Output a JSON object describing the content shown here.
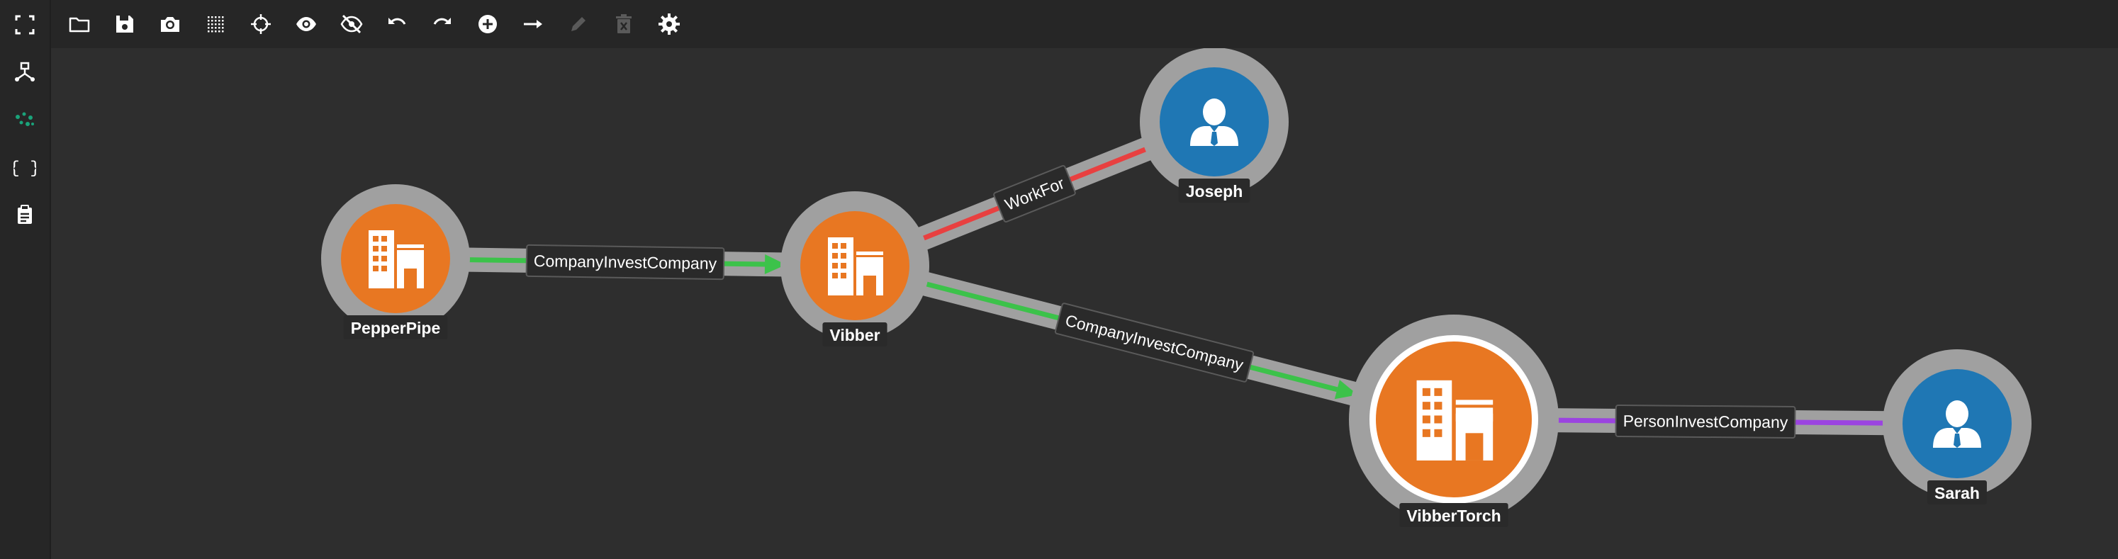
{
  "sidebar": {
    "items": [
      {
        "name": "fullscreen-icon"
      },
      {
        "name": "graph-schema-icon"
      },
      {
        "name": "graph-view-icon",
        "active_color": "#1aa37a"
      },
      {
        "name": "json-view-icon"
      },
      {
        "name": "clipboard-icon"
      }
    ]
  },
  "toolbar": {
    "items": [
      {
        "name": "open-folder-icon"
      },
      {
        "name": "save-icon"
      },
      {
        "name": "camera-icon"
      },
      {
        "name": "grid-icon"
      },
      {
        "name": "crosshair-icon"
      },
      {
        "name": "eye-icon"
      },
      {
        "name": "eye-off-icon"
      },
      {
        "name": "undo-icon"
      },
      {
        "name": "redo-icon"
      },
      {
        "name": "add-circle-icon"
      },
      {
        "name": "arrow-right-icon"
      },
      {
        "name": "edit-icon",
        "disabled": true
      },
      {
        "name": "delete-icon",
        "disabled": true
      },
      {
        "name": "settings-icon"
      }
    ]
  },
  "colors": {
    "company_node": "#e87722",
    "person_node": "#1f77b4",
    "invest_edge": "#3cc24a",
    "workfor_edge": "#e84040",
    "person_invest_edge": "#9b44e0",
    "highlight": "#a0a0a0"
  },
  "graph": {
    "nodes": [
      {
        "id": "pepperpipe",
        "label": "PepperPipe",
        "type": "company"
      },
      {
        "id": "vibber",
        "label": "Vibber",
        "type": "company"
      },
      {
        "id": "joseph",
        "label": "Joseph",
        "type": "person"
      },
      {
        "id": "vibbertorch",
        "label": "VibberTorch",
        "type": "company",
        "selected": true
      },
      {
        "id": "sarah",
        "label": "Sarah",
        "type": "person"
      }
    ],
    "edges": [
      {
        "source": "pepperpipe",
        "target": "vibber",
        "label": "CompanyInvestCompany",
        "type": "invest"
      },
      {
        "source": "vibber",
        "target": "joseph",
        "label": "WorkFor",
        "type": "workfor"
      },
      {
        "source": "vibber",
        "target": "vibbertorch",
        "label": "CompanyInvestCompany",
        "type": "invest"
      },
      {
        "source": "sarah",
        "target": "vibbertorch",
        "label": "PersonInvestCompany",
        "type": "person_invest"
      }
    ]
  }
}
